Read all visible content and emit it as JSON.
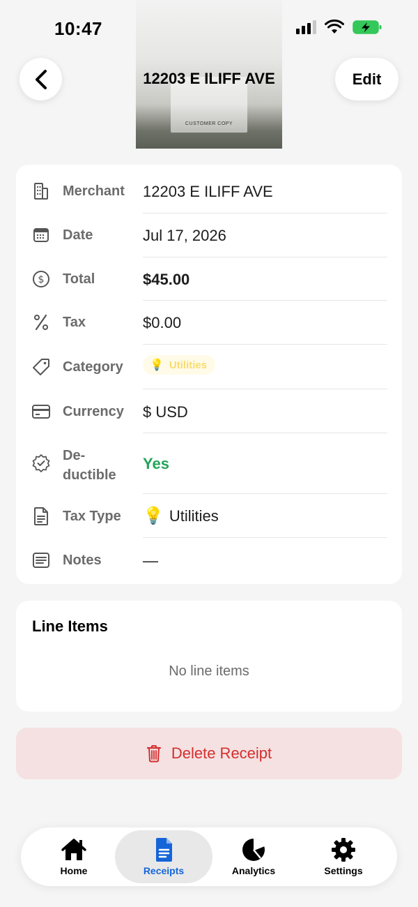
{
  "status_bar": {
    "time": "10:47"
  },
  "header": {
    "title": "12203 E ILIFF AVE",
    "edit_label": "Edit",
    "receipt_caption": "CUSTOMER COPY"
  },
  "details": {
    "rows": [
      {
        "label": "Merchant",
        "value": "12203 E ILIFF AVE",
        "icon": "building-icon"
      },
      {
        "label": "Date",
        "value": "Jul 17, 2026",
        "icon": "calendar-icon"
      },
      {
        "label": "Total",
        "value": "$45.00",
        "icon": "dollar-circle-icon"
      },
      {
        "label": "Tax",
        "value": "$0.00",
        "icon": "percent-icon"
      },
      {
        "label": "Category",
        "value": "Utilities",
        "icon": "tag-icon"
      },
      {
        "label": "Currency",
        "value": "$ USD",
        "icon": "card-icon"
      },
      {
        "label": "De-\nductible",
        "value": "Yes",
        "icon": "badge-check-icon"
      },
      {
        "label": "Tax Type",
        "value": "Utilities",
        "icon": "document-icon"
      },
      {
        "label": "Notes",
        "value": "—",
        "icon": "notes-icon"
      }
    ]
  },
  "line_items": {
    "title": "Line Items",
    "empty_text": "No line items"
  },
  "delete_label": "Delete Receipt",
  "tabs": [
    {
      "label": "Home",
      "icon": "home-icon",
      "active": false
    },
    {
      "label": "Receipts",
      "icon": "receipt-icon",
      "active": true
    },
    {
      "label": "Analytics",
      "icon": "pie-chart-icon",
      "active": false
    },
    {
      "label": "Settings",
      "icon": "gear-icon",
      "active": false
    }
  ],
  "colors": {
    "accent": "#1565d8",
    "positive": "#22a55a",
    "danger": "#d32f2f",
    "category_pill_text": "#f7dc72"
  }
}
